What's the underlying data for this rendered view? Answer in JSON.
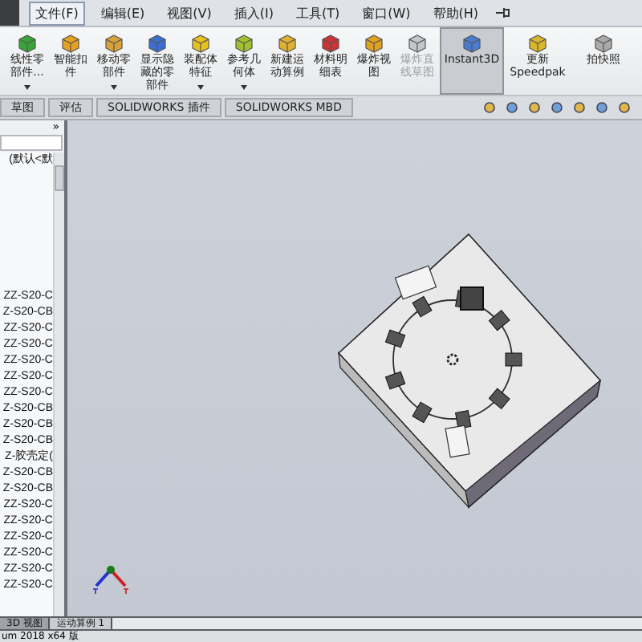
{
  "menu": [
    {
      "label": "文件(F)",
      "selected": true
    },
    {
      "label": "编辑(E)",
      "selected": false
    },
    {
      "label": "视图(V)",
      "selected": false
    },
    {
      "label": "插入(I)",
      "selected": false
    },
    {
      "label": "工具(T)",
      "selected": false
    },
    {
      "label": "窗口(W)",
      "selected": false
    },
    {
      "label": "帮助(H)",
      "selected": false
    }
  ],
  "toolbar": [
    {
      "label": "线性零部件...",
      "dropdown": true,
      "disabled": false,
      "pressed": false
    },
    {
      "label": "智能扣件",
      "dropdown": false,
      "disabled": false,
      "pressed": false
    },
    {
      "label": "移动零部件",
      "dropdown": true,
      "disabled": false,
      "pressed": false
    },
    {
      "label": "显示隐藏的零部件",
      "dropdown": false,
      "disabled": false,
      "pressed": false
    },
    {
      "label": "装配体特征",
      "dropdown": true,
      "disabled": false,
      "pressed": false
    },
    {
      "label": "参考几何体",
      "dropdown": true,
      "disabled": false,
      "pressed": false
    },
    {
      "label": "新建运动算例",
      "dropdown": false,
      "disabled": false,
      "pressed": false
    },
    {
      "label": "材料明细表",
      "dropdown": false,
      "disabled": false,
      "pressed": false
    },
    {
      "label": "爆炸视图",
      "dropdown": false,
      "disabled": false,
      "pressed": false
    },
    {
      "label": "爆炸直线草图",
      "dropdown": false,
      "disabled": true,
      "pressed": false
    },
    {
      "label": "Instant3D",
      "dropdown": false,
      "disabled": false,
      "pressed": true
    },
    {
      "label": "更新 Speedpak",
      "dropdown": false,
      "disabled": false,
      "pressed": false
    },
    {
      "label": "拍快照",
      "dropdown": false,
      "disabled": false,
      "pressed": false
    }
  ],
  "command_tabs": [
    {
      "label": "草图",
      "selected": false
    },
    {
      "label": "评估",
      "selected": false
    },
    {
      "label": "SOLIDWORKS 插件",
      "selected": false
    },
    {
      "label": "SOLIDWORKS MBD",
      "selected": false
    }
  ],
  "feature_tree": {
    "expand_glyph": "»",
    "header_text": "(默认<默",
    "items": [
      "ZZ-S20-C",
      "Z-S20-CB",
      "ZZ-S20-C",
      "ZZ-S20-C",
      "ZZ-S20-C",
      "ZZ-S20-C",
      "ZZ-S20-C",
      "Z-S20-CB",
      "Z-S20-CB",
      "Z-S20-CB",
      "Z-胶壳定(",
      "Z-S20-CB",
      "Z-S20-CB",
      "ZZ-S20-C",
      "ZZ-S20-C",
      "ZZ-S20-C",
      "ZZ-S20-C",
      "ZZ-S20-C",
      "ZZ-S20-C"
    ]
  },
  "bottom_tabs": [
    {
      "label": "3D 视图",
      "selected": false
    },
    {
      "label": "运动算例 1",
      "selected": true
    }
  ],
  "status_bar": "um 2018 x64 版"
}
